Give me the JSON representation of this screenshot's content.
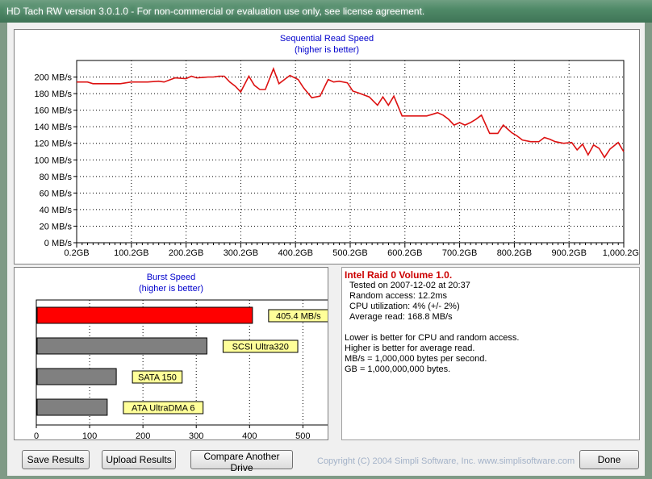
{
  "window": {
    "title": "HD Tach RW version 3.0.1.0  - For non-commercial or evaluation use only, see license agreement."
  },
  "sequential": {
    "title": "Sequential Read Speed",
    "subtitle": "(higher is better)"
  },
  "burst": {
    "title": "Burst Speed",
    "subtitle": "(higher is better)"
  },
  "info": {
    "heading": "Intel Raid 0 Volume 1.0.",
    "lines": [
      "Tested on 2007-12-02 at 20:37",
      "Random access: 12.2ms",
      "CPU utilization: 4% (+/- 2%)",
      "Average read: 168.8 MB/s"
    ],
    "notes": [
      "Lower is better for CPU and random access.",
      "Higher is better for average read.",
      "MB/s = 1,000,000 bytes per second.",
      "GB = 1,000,000,000 bytes."
    ]
  },
  "buttons": {
    "save": "Save Results",
    "upload": "Upload Results",
    "compare": "Compare Another Drive",
    "done": "Done"
  },
  "copyright": "Copyright (C) 2004 Simpli Software, Inc. www.simplisoftware.com",
  "colors": {
    "series": "#dd1111",
    "burst_main": "#ff0000",
    "burst_ref": "#808080",
    "label_bg": "#ffff99",
    "heading": "#cc0000",
    "chart_title": "#0000cc"
  },
  "chart_data": [
    {
      "type": "line",
      "title": "Sequential Read Speed",
      "subtitle": "(higher is better)",
      "xlim": [
        0.2,
        1000.2
      ],
      "ylim": [
        0,
        220
      ],
      "x_tick_labels": [
        "0.2GB",
        "100.2GB",
        "200.2GB",
        "300.2GB",
        "400.2GB",
        "500.2GB",
        "600.2GB",
        "700.2GB",
        "800.2GB",
        "900.2GB",
        "1,000.2GB"
      ],
      "x_ticks": [
        0.2,
        100.2,
        200.2,
        300.2,
        400.2,
        500.2,
        600.2,
        700.2,
        800.2,
        900.2,
        1000.2
      ],
      "y_tick_labels": [
        "0 MB/s",
        "20 MB/s",
        "40 MB/s",
        "60 MB/s",
        "80 MB/s",
        "100 MB/s",
        "120 MB/s",
        "140 MB/s",
        "160 MB/s",
        "180 MB/s",
        "200 MB/s"
      ],
      "y_ticks": [
        0,
        20,
        40,
        60,
        80,
        100,
        120,
        140,
        160,
        180,
        200
      ],
      "grid": true,
      "series": [
        {
          "x": [
            0.2,
            20,
            30,
            60,
            80,
            100,
            130,
            150,
            160,
            180,
            200,
            210,
            220,
            240,
            250,
            260,
            270,
            280,
            290,
            300,
            315,
            325,
            335,
            345,
            360,
            370,
            380,
            390,
            405,
            415,
            430,
            445,
            460,
            470,
            480,
            495,
            505,
            515,
            535,
            550,
            560,
            570,
            580,
            595,
            605,
            620,
            640,
            650,
            660,
            670,
            680,
            690,
            700,
            710,
            720,
            730,
            740,
            755,
            770,
            780,
            795,
            805,
            815,
            830,
            845,
            855,
            865,
            875,
            890,
            905,
            915,
            925,
            935,
            945,
            955,
            965,
            975,
            990,
            1000
          ],
          "y": [
            194,
            194,
            192,
            192,
            192,
            194,
            194,
            195,
            194,
            199,
            198,
            201,
            199,
            200,
            200,
            201,
            201,
            194,
            189,
            182,
            201,
            190,
            185,
            185,
            210,
            192,
            197,
            202,
            197,
            187,
            175,
            177,
            197,
            194,
            195,
            193,
            183,
            181,
            176,
            166,
            176,
            166,
            177,
            153,
            153,
            153,
            153,
            155,
            157,
            154,
            149,
            142,
            145,
            142,
            145,
            149,
            154,
            132,
            132,
            142,
            133,
            129,
            124,
            122,
            122,
            127,
            125,
            122,
            120,
            121,
            112,
            119,
            106,
            118,
            114,
            103,
            113,
            121,
            110
          ]
        }
      ]
    },
    {
      "type": "bar",
      "title": "Burst Speed",
      "subtitle": "(higher is better)",
      "orientation": "horizontal",
      "xlim": [
        0,
        560
      ],
      "x_tick_labels": [
        "0",
        "100",
        "200",
        "300",
        "400",
        "500"
      ],
      "x_ticks": [
        0,
        100,
        200,
        300,
        400,
        500
      ],
      "grid": true,
      "categories": [
        "405.4 MB/s",
        "SCSI Ultra320",
        "SATA 150",
        "ATA UltraDMA 6"
      ],
      "values": [
        405.4,
        320,
        150,
        133
      ],
      "bar_colors": [
        "#ff0000",
        "#808080",
        "#808080",
        "#808080"
      ]
    }
  ]
}
